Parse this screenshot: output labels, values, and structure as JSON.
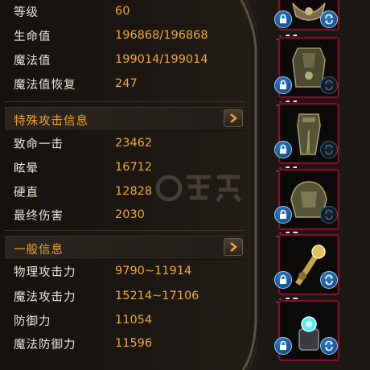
{
  "basic_stats": [
    {
      "label": "等级",
      "value": "60"
    },
    {
      "label": "生命值",
      "value": "196868/196868"
    },
    {
      "label": "魔法值",
      "value": "199014/199014"
    },
    {
      "label": "魔法值恢复",
      "value": "247"
    }
  ],
  "special_attack": {
    "title": "特殊攻击信息",
    "rows": [
      {
        "label": "致命一击",
        "value": "23462"
      },
      {
        "label": "眩晕",
        "value": "16712"
      },
      {
        "label": "硬直",
        "value": "12828"
      },
      {
        "label": "最终伤害",
        "value": "2030"
      }
    ]
  },
  "general_info": {
    "title": "一般信息",
    "rows": [
      {
        "label": "物理攻击力",
        "value": "9790~11914"
      },
      {
        "label": "魔法攻击力",
        "value": "15214~17106"
      },
      {
        "label": "防御力",
        "value": "11054"
      },
      {
        "label": "魔法防御力",
        "value": "11596"
      }
    ]
  },
  "equipment_slots": [
    {
      "enhance": "",
      "art": "armor-piece-icon",
      "swap_active": true
    },
    {
      "enhance": "+11",
      "art": "chest-armor-icon",
      "swap_active": false
    },
    {
      "enhance": "+11",
      "art": "leg-armor-icon",
      "swap_active": false
    },
    {
      "enhance": "+11",
      "art": "shoulder-armor-icon",
      "swap_active": false
    },
    {
      "enhance": "+13",
      "art": "amulet-icon",
      "swap_active": true
    },
    {
      "enhance": "+13",
      "art": "ring-icon",
      "swap_active": true
    }
  ],
  "colors": {
    "label": "#e9e3d6",
    "value": "#f4a830",
    "section_title": "#f3a226",
    "slot_border": "#7a1228",
    "lock_blue": "#2d7fc7"
  }
}
